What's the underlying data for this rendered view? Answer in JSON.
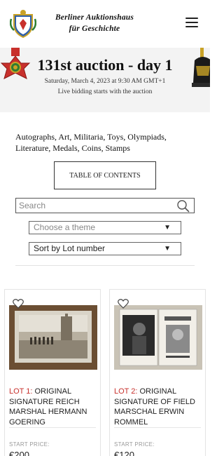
{
  "header": {
    "logo_line1": "Berliner Auktionshaus",
    "logo_line2": "für Geschichte"
  },
  "banner": {
    "title": "131st auction - day 1",
    "date": "Saturday, March 4, 2023 at 9:30 AM GMT+1",
    "live_note": "Live bidding starts with the auction"
  },
  "categories": "Autographs, Art, Militaria, Toys, Olympiads, Literature, Medals, Coins, Stamps",
  "toc_label": "TABLE OF CONTENTS",
  "search": {
    "placeholder": "Search"
  },
  "filters": {
    "theme_value": "Choose a theme",
    "sort_value": "Sort by Lot number"
  },
  "lots": [
    {
      "lot_label": "LOT 1:",
      "title": "ORIGINAL SIGNATURE REICH MARSHAL HERMANN GOERING",
      "start_price_label": "START PRICE:",
      "start_price": "€200"
    },
    {
      "lot_label": "LOT 2:",
      "title": "ORIGINAL SIGNATURE OF FIELD MARSCHAL ERWIN ROMMEL",
      "start_price_label": "START PRICE:",
      "start_price": "€120"
    }
  ],
  "colors": {
    "accent": "#c8302c",
    "banner_bg": "#f3f3f3"
  }
}
